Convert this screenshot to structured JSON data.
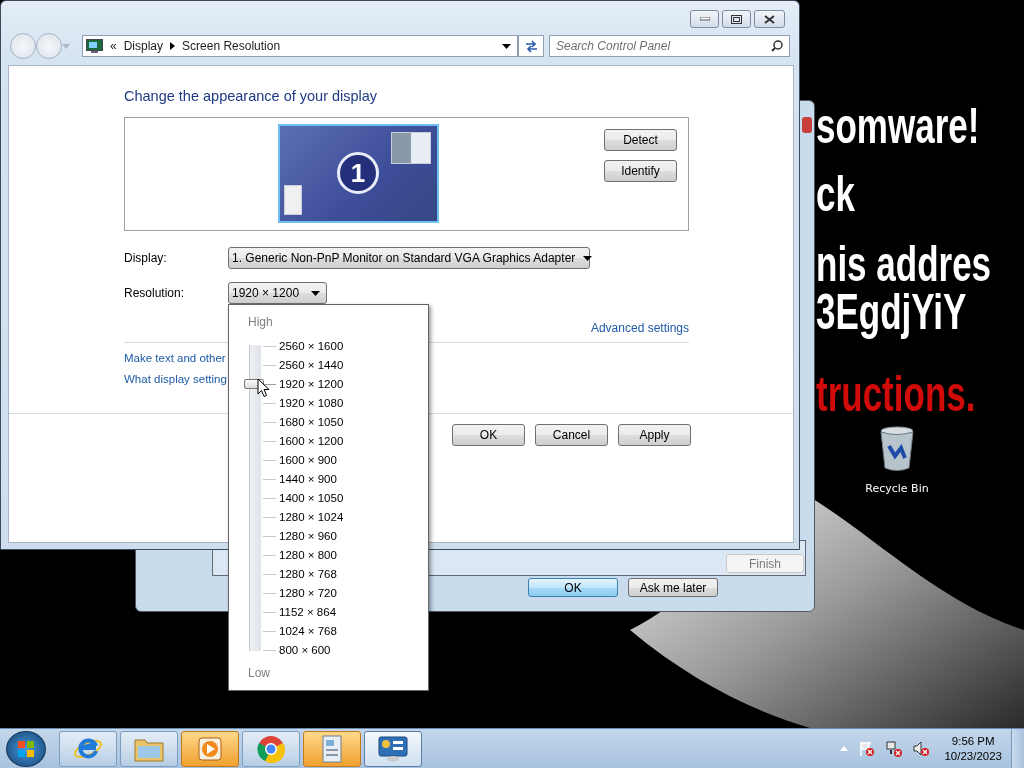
{
  "address_bar": {
    "overflow_glyph": "«",
    "crumbs": [
      "Display",
      "Screen Resolution"
    ]
  },
  "search": {
    "placeholder": "Search Control Panel"
  },
  "heading": "Change the appearance of your display",
  "monitor": {
    "number": "1"
  },
  "monitor_buttons": [
    "Detect",
    "Identify"
  ],
  "display": {
    "label": "Display:",
    "value": "1. Generic Non-PnP Monitor on Standard VGA Graphics Adapter"
  },
  "resolution": {
    "label": "Resolution:",
    "value": "1920 × 1200"
  },
  "resolution_popup": {
    "high_label": "High",
    "low_label": "Low",
    "options": [
      {
        "label": "2560 × 1600",
        "selected": false
      },
      {
        "label": "2560 × 1440",
        "selected": false
      },
      {
        "label": "1920 × 1200",
        "selected": true
      },
      {
        "label": "1920 × 1080",
        "selected": false
      },
      {
        "label": "1680 × 1050",
        "selected": false
      },
      {
        "label": "1600 × 1200",
        "selected": false
      },
      {
        "label": "1600 × 900",
        "selected": false
      },
      {
        "label": "1440 × 900",
        "selected": false
      },
      {
        "label": "1400 × 1050",
        "selected": false
      },
      {
        "label": "1280 × 1024",
        "selected": false
      },
      {
        "label": "1280 × 960",
        "selected": false
      },
      {
        "label": "1280 × 800",
        "selected": false
      },
      {
        "label": "1280 × 768",
        "selected": false
      },
      {
        "label": "1280 × 720",
        "selected": false
      },
      {
        "label": "1152 × 864",
        "selected": false
      },
      {
        "label": "1024 × 768",
        "selected": false
      },
      {
        "label": "800 × 600",
        "selected": false
      }
    ]
  },
  "advanced_link": "Advanced settings",
  "links": [
    "Make text and other",
    "What display setting"
  ],
  "dialog_buttons": [
    "OK",
    "Cancel",
    "Apply"
  ],
  "back_windows": {
    "wizard_button": {
      "label": "Finish",
      "disabled": true
    },
    "buttons": [
      {
        "label": "OK",
        "default": true
      },
      {
        "label": "Ask me later",
        "default": false
      }
    ]
  },
  "wallpaper_text": [
    {
      "text": "somware!",
      "color": "#ffffff"
    },
    {
      "text": "ck",
      "color": "#ffffff"
    },
    {
      "text": "nis addres",
      "color": "#ffffff"
    },
    {
      "text": "3EgdjYiY",
      "color": "#ffffff"
    },
    {
      "text": "tructions.",
      "color": "#d10a0a"
    }
  ],
  "desktop_icons": [
    {
      "label": "Recycle Bin"
    }
  ],
  "taskbar": {
    "items": [
      {
        "kind": "ie",
        "selected": false,
        "flashing": false
      },
      {
        "kind": "explorer",
        "selected": false,
        "flashing": false
      },
      {
        "kind": "media",
        "selected": false,
        "flashing": true
      },
      {
        "kind": "chrome",
        "selected": false,
        "flashing": false
      },
      {
        "kind": "document",
        "selected": false,
        "flashing": true
      },
      {
        "kind": "control",
        "selected": true,
        "flashing": false
      }
    ],
    "clock": {
      "time": "9:56 PM",
      "date": "10/23/2023"
    }
  }
}
